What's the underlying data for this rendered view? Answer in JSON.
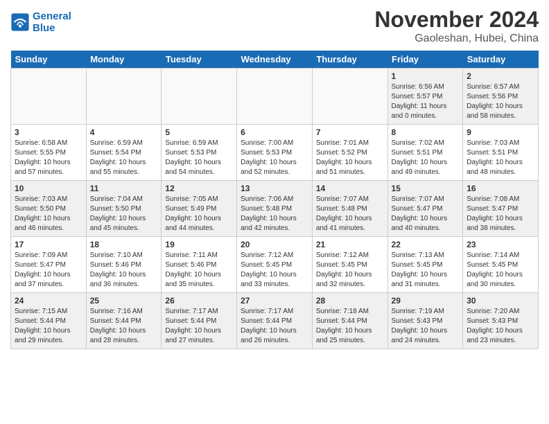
{
  "header": {
    "logo_line1": "General",
    "logo_line2": "Blue",
    "month": "November 2024",
    "location": "Gaoleshan, Hubei, China"
  },
  "weekdays": [
    "Sunday",
    "Monday",
    "Tuesday",
    "Wednesday",
    "Thursday",
    "Friday",
    "Saturday"
  ],
  "weeks": [
    [
      {
        "day": "",
        "info": ""
      },
      {
        "day": "",
        "info": ""
      },
      {
        "day": "",
        "info": ""
      },
      {
        "day": "",
        "info": ""
      },
      {
        "day": "",
        "info": ""
      },
      {
        "day": "1",
        "info": "Sunrise: 6:56 AM\nSunset: 5:57 PM\nDaylight: 11 hours\nand 0 minutes."
      },
      {
        "day": "2",
        "info": "Sunrise: 6:57 AM\nSunset: 5:56 PM\nDaylight: 10 hours\nand 58 minutes."
      }
    ],
    [
      {
        "day": "3",
        "info": "Sunrise: 6:58 AM\nSunset: 5:55 PM\nDaylight: 10 hours\nand 57 minutes."
      },
      {
        "day": "4",
        "info": "Sunrise: 6:59 AM\nSunset: 5:54 PM\nDaylight: 10 hours\nand 55 minutes."
      },
      {
        "day": "5",
        "info": "Sunrise: 6:59 AM\nSunset: 5:53 PM\nDaylight: 10 hours\nand 54 minutes."
      },
      {
        "day": "6",
        "info": "Sunrise: 7:00 AM\nSunset: 5:53 PM\nDaylight: 10 hours\nand 52 minutes."
      },
      {
        "day": "7",
        "info": "Sunrise: 7:01 AM\nSunset: 5:52 PM\nDaylight: 10 hours\nand 51 minutes."
      },
      {
        "day": "8",
        "info": "Sunrise: 7:02 AM\nSunset: 5:51 PM\nDaylight: 10 hours\nand 49 minutes."
      },
      {
        "day": "9",
        "info": "Sunrise: 7:03 AM\nSunset: 5:51 PM\nDaylight: 10 hours\nand 48 minutes."
      }
    ],
    [
      {
        "day": "10",
        "info": "Sunrise: 7:03 AM\nSunset: 5:50 PM\nDaylight: 10 hours\nand 46 minutes."
      },
      {
        "day": "11",
        "info": "Sunrise: 7:04 AM\nSunset: 5:50 PM\nDaylight: 10 hours\nand 45 minutes."
      },
      {
        "day": "12",
        "info": "Sunrise: 7:05 AM\nSunset: 5:49 PM\nDaylight: 10 hours\nand 44 minutes."
      },
      {
        "day": "13",
        "info": "Sunrise: 7:06 AM\nSunset: 5:48 PM\nDaylight: 10 hours\nand 42 minutes."
      },
      {
        "day": "14",
        "info": "Sunrise: 7:07 AM\nSunset: 5:48 PM\nDaylight: 10 hours\nand 41 minutes."
      },
      {
        "day": "15",
        "info": "Sunrise: 7:07 AM\nSunset: 5:47 PM\nDaylight: 10 hours\nand 40 minutes."
      },
      {
        "day": "16",
        "info": "Sunrise: 7:08 AM\nSunset: 5:47 PM\nDaylight: 10 hours\nand 38 minutes."
      }
    ],
    [
      {
        "day": "17",
        "info": "Sunrise: 7:09 AM\nSunset: 5:47 PM\nDaylight: 10 hours\nand 37 minutes."
      },
      {
        "day": "18",
        "info": "Sunrise: 7:10 AM\nSunset: 5:46 PM\nDaylight: 10 hours\nand 36 minutes."
      },
      {
        "day": "19",
        "info": "Sunrise: 7:11 AM\nSunset: 5:46 PM\nDaylight: 10 hours\nand 35 minutes."
      },
      {
        "day": "20",
        "info": "Sunrise: 7:12 AM\nSunset: 5:45 PM\nDaylight: 10 hours\nand 33 minutes."
      },
      {
        "day": "21",
        "info": "Sunrise: 7:12 AM\nSunset: 5:45 PM\nDaylight: 10 hours\nand 32 minutes."
      },
      {
        "day": "22",
        "info": "Sunrise: 7:13 AM\nSunset: 5:45 PM\nDaylight: 10 hours\nand 31 minutes."
      },
      {
        "day": "23",
        "info": "Sunrise: 7:14 AM\nSunset: 5:45 PM\nDaylight: 10 hours\nand 30 minutes."
      }
    ],
    [
      {
        "day": "24",
        "info": "Sunrise: 7:15 AM\nSunset: 5:44 PM\nDaylight: 10 hours\nand 29 minutes."
      },
      {
        "day": "25",
        "info": "Sunrise: 7:16 AM\nSunset: 5:44 PM\nDaylight: 10 hours\nand 28 minutes."
      },
      {
        "day": "26",
        "info": "Sunrise: 7:17 AM\nSunset: 5:44 PM\nDaylight: 10 hours\nand 27 minutes."
      },
      {
        "day": "27",
        "info": "Sunrise: 7:17 AM\nSunset: 5:44 PM\nDaylight: 10 hours\nand 26 minutes."
      },
      {
        "day": "28",
        "info": "Sunrise: 7:18 AM\nSunset: 5:44 PM\nDaylight: 10 hours\nand 25 minutes."
      },
      {
        "day": "29",
        "info": "Sunrise: 7:19 AM\nSunset: 5:43 PM\nDaylight: 10 hours\nand 24 minutes."
      },
      {
        "day": "30",
        "info": "Sunrise: 7:20 AM\nSunset: 5:43 PM\nDaylight: 10 hours\nand 23 minutes."
      }
    ]
  ]
}
